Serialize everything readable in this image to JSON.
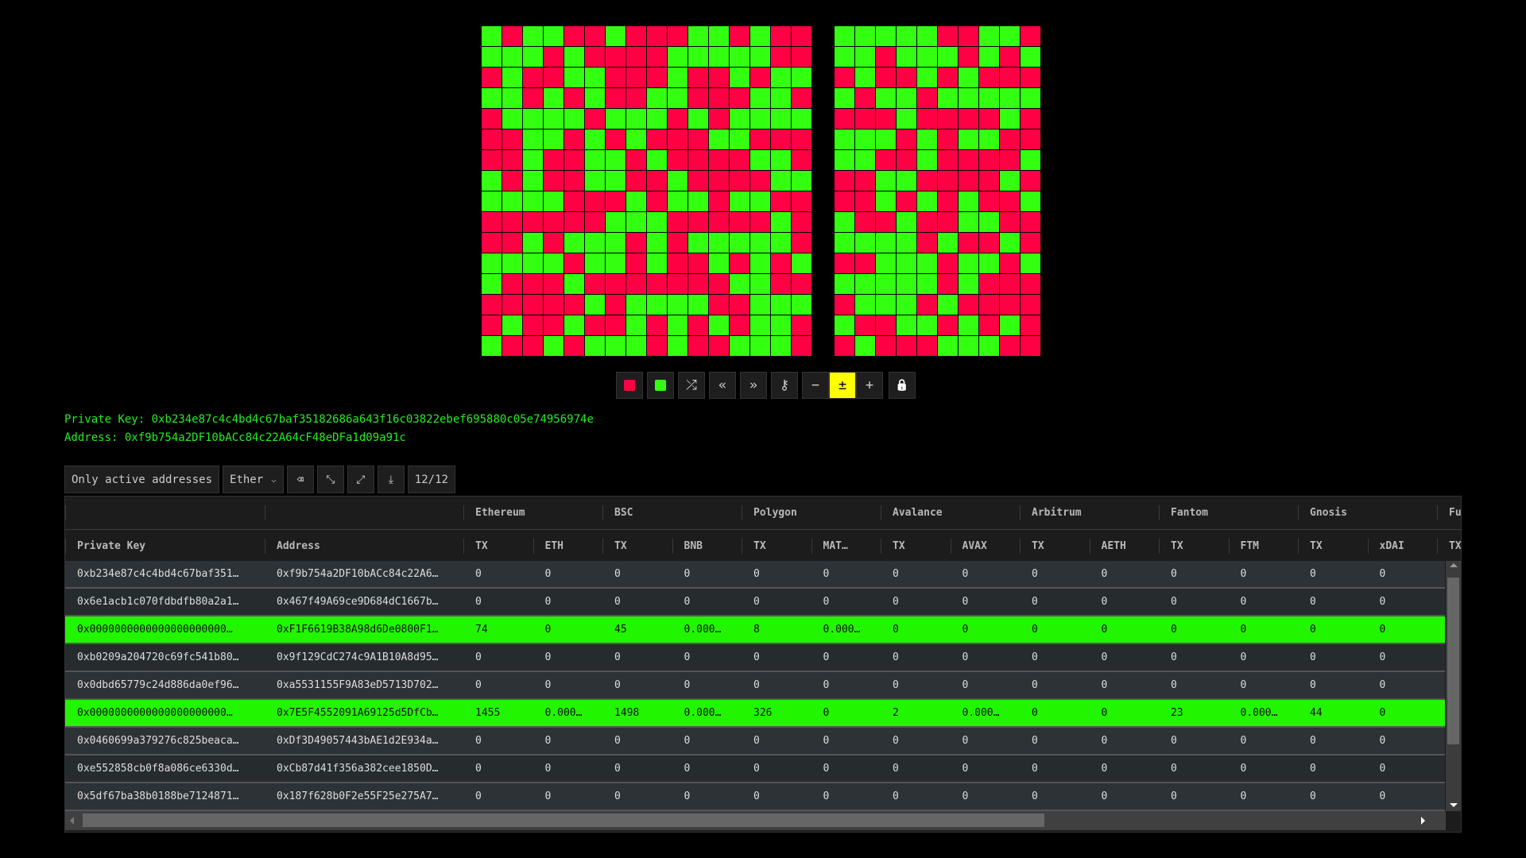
{
  "colors": {
    "bit_one": "#33ff11",
    "bit_zero": "#ff0044",
    "active_row": "#22f500",
    "accent_highlight": "#ffff00"
  },
  "key_hex": "b234e87c4c4bd4c67baf35182686a643f16c03822ebef695880c05e74956974e",
  "address_hex": "f9b754a2DF10bACc84c22A64cF48eDFa1d09a91c",
  "toolbar": [
    {
      "name": "set-red-button",
      "icon": "red-square-icon"
    },
    {
      "name": "set-green-button",
      "icon": "green-square-icon"
    },
    {
      "name": "shuffle-button",
      "icon": "shuffle-icon",
      "glyph": "⤮"
    },
    {
      "name": "previous-button",
      "icon": "double-chevron-left-icon",
      "glyph": "«"
    },
    {
      "name": "next-button",
      "icon": "double-chevron-right-icon",
      "glyph": "»"
    },
    {
      "name": "key-button",
      "icon": "key-icon",
      "glyph": "⚷"
    },
    {
      "name": "decrement-button",
      "icon": "minus-icon",
      "glyph": "−"
    },
    {
      "name": "plus-minus-button",
      "icon": "plus-minus-icon",
      "glyph": "±",
      "active": true
    },
    {
      "name": "increment-button",
      "icon": "plus-icon",
      "glyph": "+"
    },
    {
      "name": "lock-button",
      "icon": "lock-icon",
      "glyph": "🔒"
    }
  ],
  "info": {
    "private_key": "Private Key: 0xb234e87c4c4bd4c67baf35182686a643f16c03822ebef695880c05e74956974e",
    "address": "Address: 0xf9b754a2DF10bACc84c22A64cF48eDFa1d09a91c"
  },
  "controls": {
    "only_active": "Only active addresses",
    "currency": "Ether",
    "counter": "12/12",
    "icons": [
      "eraser-icon",
      "collapse-icon",
      "expand-icon",
      "download-icon"
    ]
  },
  "table": {
    "groups": [
      "",
      "",
      "Ethereum",
      "BSC",
      "Polygon",
      "Avalance",
      "Arbitrum",
      "Fantom",
      "Gnosis",
      "Fu"
    ],
    "columns": [
      "Private Key",
      "Address",
      "TX",
      "ETH",
      "TX",
      "BNB",
      "TX",
      "MAT…",
      "TX",
      "AVAX",
      "TX",
      "AETH",
      "TX",
      "FTM",
      "TX",
      "xDAI",
      "TX"
    ],
    "rows": [
      {
        "active": false,
        "cells": [
          "0xb234e87c4c4bd4c67baf351…",
          "0xf9b754a2DF10bACc84c22A6…",
          "0",
          "0",
          "0",
          "0",
          "0",
          "0",
          "0",
          "0",
          "0",
          "0",
          "0",
          "0",
          "0",
          "0"
        ]
      },
      {
        "active": false,
        "cells": [
          "0x6e1acb1c070fdbdfb80a2a1…",
          "0x467f49A69ce9D684dC1667b…",
          "0",
          "0",
          "0",
          "0",
          "0",
          "0",
          "0",
          "0",
          "0",
          "0",
          "0",
          "0",
          "0",
          "0"
        ]
      },
      {
        "active": true,
        "cells": [
          "0x0000000000000000000000…",
          "0xF1F6619B38A98d6De0800F1…",
          "74",
          "0",
          "45",
          "0.000…",
          "8",
          "0.000…",
          "0",
          "0",
          "0",
          "0",
          "0",
          "0",
          "0",
          "0"
        ]
      },
      {
        "active": false,
        "cells": [
          "0xb0209a204720c69fc541b80…",
          "0x9f129CdC274c9A1B10A8d95…",
          "0",
          "0",
          "0",
          "0",
          "0",
          "0",
          "0",
          "0",
          "0",
          "0",
          "0",
          "0",
          "0",
          "0"
        ]
      },
      {
        "active": false,
        "cells": [
          "0x0dbd65779c24d886da0ef96…",
          "0xa5531155F9A83eD5713D702…",
          "0",
          "0",
          "0",
          "0",
          "0",
          "0",
          "0",
          "0",
          "0",
          "0",
          "0",
          "0",
          "0",
          "0"
        ]
      },
      {
        "active": true,
        "cells": [
          "0x0000000000000000000000…",
          "0x7E5F4552091A69125d5DfCb…",
          "1455",
          "0.000…",
          "1498",
          "0.000…",
          "326",
          "0",
          "2",
          "0.000…",
          "0",
          "0",
          "23",
          "0.000…",
          "44",
          "0"
        ]
      },
      {
        "active": false,
        "cells": [
          "0x0460699a379276c825beaca…",
          "0xDf3D49057443bAE1d2E934a…",
          "0",
          "0",
          "0",
          "0",
          "0",
          "0",
          "0",
          "0",
          "0",
          "0",
          "0",
          "0",
          "0",
          "0"
        ]
      },
      {
        "active": false,
        "cells": [
          "0xe552858cb0f8a086ce6330d…",
          "0xCb87d41f356a382cee1850D…",
          "0",
          "0",
          "0",
          "0",
          "0",
          "0",
          "0",
          "0",
          "0",
          "0",
          "0",
          "0",
          "0",
          "0"
        ]
      },
      {
        "active": false,
        "cells": [
          "0x5df67ba38b0188be7124871…",
          "0x187f628b0F2e55F25e275A7…",
          "0",
          "0",
          "0",
          "0",
          "0",
          "0",
          "0",
          "0",
          "0",
          "0",
          "0",
          "0",
          "0",
          "0"
        ]
      }
    ]
  }
}
